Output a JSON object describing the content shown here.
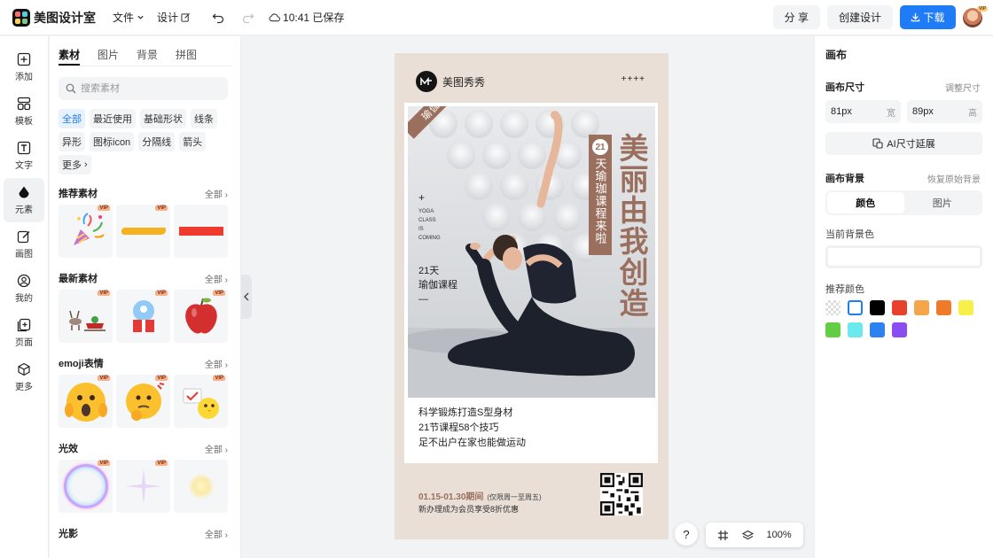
{
  "app": {
    "logo_text": "美图设计室"
  },
  "topbar": {
    "file_menu": "文件",
    "design_menu": "设计",
    "save_status": "10:41 已保存",
    "share_label": "分 享",
    "create_label": "创建设计",
    "download_label": "下载",
    "avatar_badge": "VIP"
  },
  "rail": [
    {
      "label": "添加",
      "icon": "plus-square-icon"
    },
    {
      "label": "模板",
      "icon": "template-icon"
    },
    {
      "label": "文字",
      "icon": "text-icon"
    },
    {
      "label": "元素",
      "icon": "shapes-icon"
    },
    {
      "label": "画图",
      "icon": "draw-icon"
    },
    {
      "label": "我的",
      "icon": "user-icon"
    },
    {
      "label": "页面",
      "icon": "page-add-icon"
    },
    {
      "label": "更多",
      "icon": "cube-icon"
    }
  ],
  "panel": {
    "tabs": [
      "素材",
      "图片",
      "背景",
      "拼图"
    ],
    "search_placeholder": "搜索素材",
    "chips": [
      "全部",
      "最近使用",
      "基础形状",
      "线条",
      "异形",
      "图标icon",
      "分隔线",
      "箭头",
      "更多"
    ],
    "vip": "VIP",
    "all_label": "全部",
    "sections": {
      "recommended": "推荐素材",
      "newest": "最新素材",
      "emoji": "emoji表情",
      "light": "光效",
      "shadow": "光影"
    }
  },
  "poster": {
    "brand": "美图秀秀",
    "plus_marks": "++++",
    "ribbon": "瑜伽亮点",
    "plus": "+",
    "small_lines": [
      "YOGA",
      "CLASS",
      "IS",
      "COMING"
    ],
    "days_lines": [
      "21天",
      "瑜伽课程",
      "—"
    ],
    "badge_num": "21",
    "vertical_text": "天瑜珈课程来啦",
    "big_title": "美丽由我创造",
    "desc_lines": [
      "科学锻炼打造S型身材",
      "21节课程58个技巧",
      "足不出户在家也能做运动"
    ],
    "date": "01.15-01.30期间",
    "date_sub": "(仅限周一至周五)",
    "member": "新办理成为会员享受8折优惠"
  },
  "canvas_tools": {
    "help": "?",
    "zoom": "100%"
  },
  "right_panel": {
    "title": "画布",
    "size_label": "画布尺寸",
    "adjust_link": "调整尺寸",
    "width_value": "81px",
    "width_unit": "宽",
    "height_value": "89px",
    "height_unit": "高",
    "ai_button": "AI尺寸延展",
    "bg_label": "画布背景",
    "restore_link": "恢复原始背景",
    "seg_color": "颜色",
    "seg_image": "图片",
    "current_bg_label": "当前背景色",
    "recommend_label": "推荐颜色",
    "swatches": [
      "transparent",
      "#ffffff",
      "#000000",
      "#e8412c",
      "#f5a54a",
      "#ef7a2a",
      "#f7ef4a",
      "#62cd45",
      "#6ce9ee",
      "#2b82f0",
      "#8a4df0"
    ]
  },
  "colors": {
    "accent": "#1f7cf7",
    "poster_brown": "#9b6f5e",
    "poster_bg": "#e9dfd6"
  }
}
